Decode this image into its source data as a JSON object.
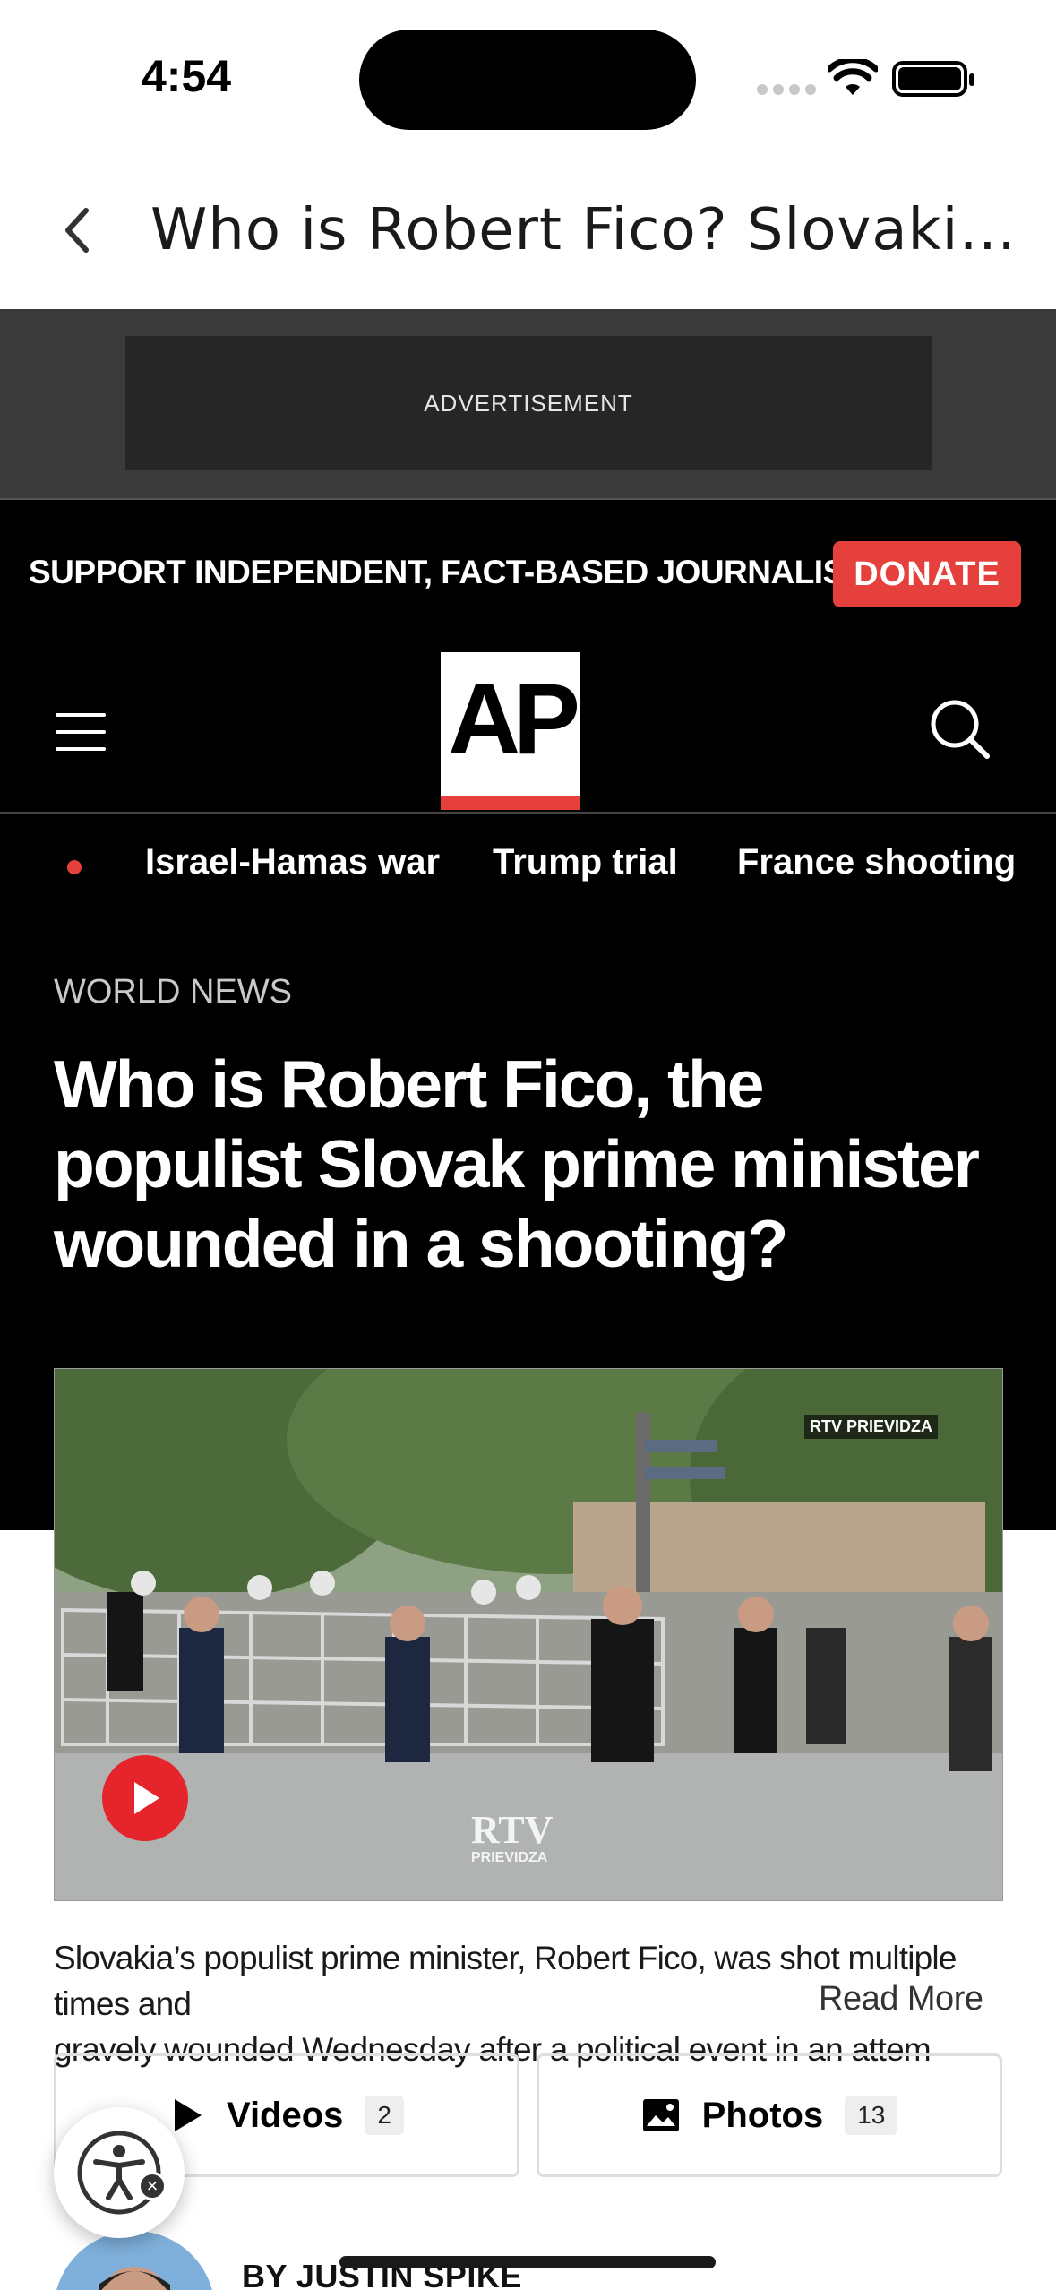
{
  "status_bar": {
    "time": "4:54"
  },
  "header": {
    "title": "Who is Robert Fico? Slovakia's…"
  },
  "ad": {
    "label": "ADVERTISEMENT"
  },
  "site": {
    "support_text": "SUPPORT INDEPENDENT, FACT-BASED JOURNALISM.",
    "donate_label": "DONATE",
    "logo_text": "AP",
    "topics": [
      "Israel-Hamas war",
      "Trump trial",
      "France shooting"
    ]
  },
  "article": {
    "section": "WORLD NEWS",
    "headline": "Who is Robert Fico, the populist Slovak prime minister wounded in a shooting?",
    "video_watermark": "RTV PRIEVIDZA",
    "video_logo": "RTV",
    "video_logo_sub": "PRIEVIDZA",
    "caption_line1": "Slovakia’s populist prime minister, Robert Fico, was shot multiple times and",
    "caption_line2": "gravely wounded Wednesday after a political event in an attem",
    "read_more": "Read More",
    "videos_label": "Videos",
    "videos_count": "2",
    "photos_label": "Photos",
    "photos_count": "13",
    "byline": "BY  JUSTIN SPIKE"
  },
  "colors": {
    "accent_red": "#e5403b",
    "header_bg": "#000000"
  },
  "icons": [
    "back-chevron-icon",
    "wifi-icon",
    "battery-icon",
    "menu-icon",
    "search-icon",
    "play-icon",
    "photo-icon",
    "accessibility-icon"
  ]
}
